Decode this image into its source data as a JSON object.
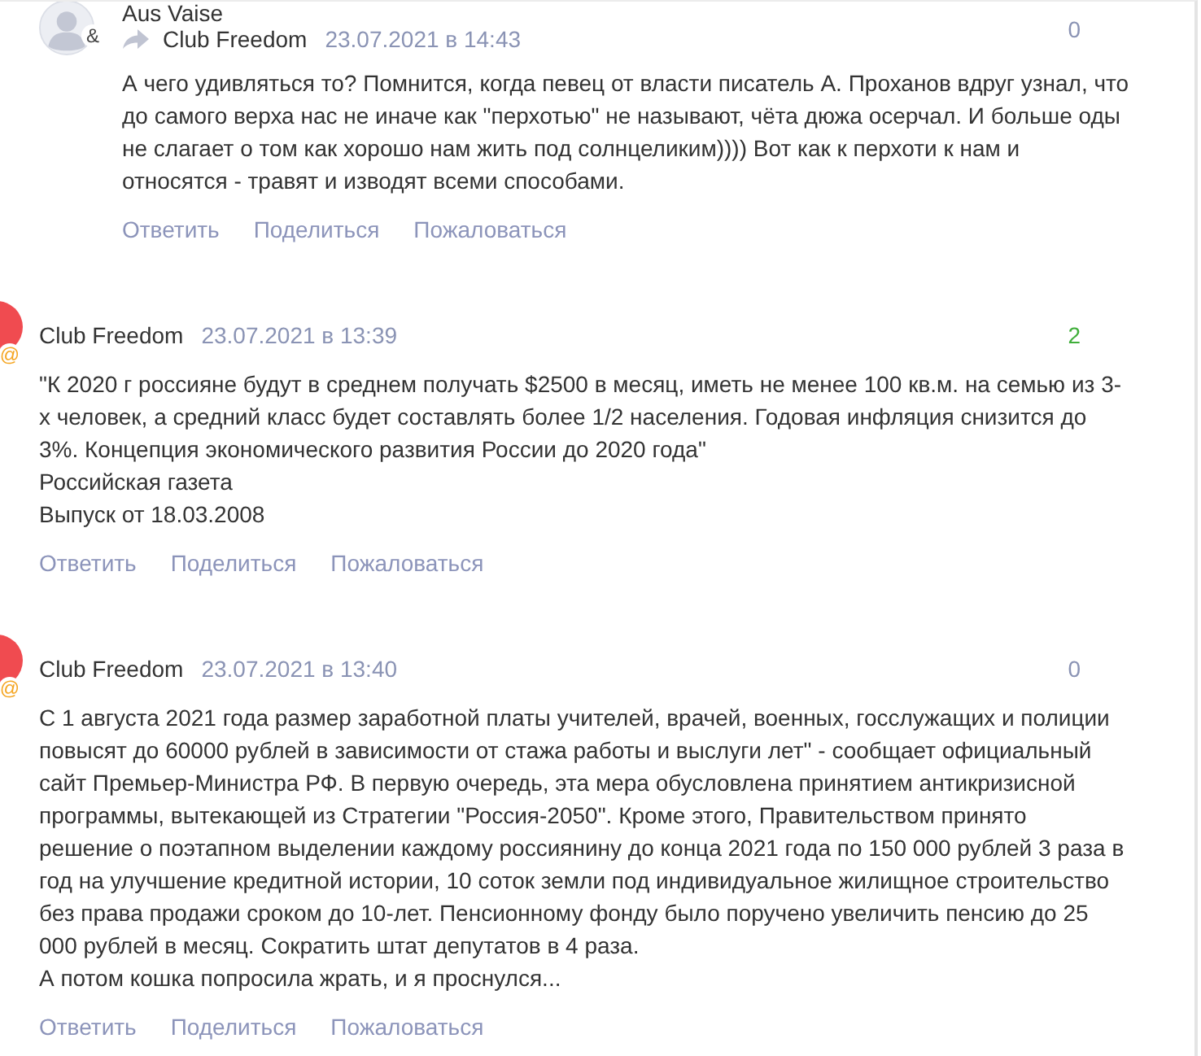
{
  "comments": [
    {
      "kind": "reply",
      "avatar": {
        "kind": "silhouette",
        "badge": {
          "text": "&",
          "color": "#444444"
        }
      },
      "author": "Aus Vaise",
      "reply_to": "Club Freedom",
      "date": "23.07.2021 в 14:43",
      "score": "0",
      "score_positive": false,
      "text": "А чего удивляться то? Помнится, когда певец от власти писатель А. Проханов вдруг узнал, что до самого верха нас не иначе как \"перхотью\" не называют, чёта дюжа осерчал. И больше оды не слагает о том как хорошо нам жить под солнцеликим)))) Вот как к перхоти к нам и относятся - травят и изводят всеми способами.",
      "actions": [
        "Ответить",
        "Поделиться",
        "Пожаловаться"
      ]
    },
    {
      "kind": "top",
      "avatar": {
        "kind": "plain",
        "color": "#f04b50",
        "badge": {
          "text": "@",
          "color": "#f5a623"
        }
      },
      "author": "Club Freedom",
      "date": "23.07.2021 в 13:39",
      "score": "2",
      "score_positive": true,
      "text": "\"К 2020 г россияне будут в среднем получать $2500 в месяц, иметь не менее 100 кв.м. на семью из 3-х человек, а средний класс будет составлять более 1/2 населения. Годовая инфляция снизится до 3%. Концепция экономического развития России до 2020 года\"\nРоссийская газета\nВыпуск от 18.03.2008",
      "actions": [
        "Ответить",
        "Поделиться",
        "Пожаловаться"
      ]
    },
    {
      "kind": "top",
      "avatar": {
        "kind": "plain",
        "color": "#f04b50",
        "badge": {
          "text": "@",
          "color": "#f5a623"
        }
      },
      "author": "Club Freedom",
      "date": "23.07.2021 в 13:40",
      "score": "0",
      "score_positive": false,
      "text": "С 1 августа 2021 года размер заработной платы учителей, врачей, военных, госслужащих и полиции повысят до 60000 рублей в зависимости от стажа работы и выслуги лет\" - сообщает официальный сайт Премьер-Министра РФ. В первую очередь, эта мера обусловлена принятием антикризисной программы, вытекающей из Стратегии \"Россия-2050\". Кроме этого, Правительством принято решение о поэтапном выделении каждому россиянину до конца 2021 года по 150 000 рублей 3 раза в год на улучшение кредитной истории, 10 соток земли под индивидуальное жилищное строительство без права продажи сроком до 10-лет. Пенсионному фонду было поручено увеличить пенсию до 25 000 рублей в месяц. Сократить штат депутатов в 4 раза.\nА потом кошка попросила жрать, и я проснулся...",
      "actions": [
        "Ответить",
        "Поделиться",
        "Пожаловаться"
      ]
    }
  ]
}
